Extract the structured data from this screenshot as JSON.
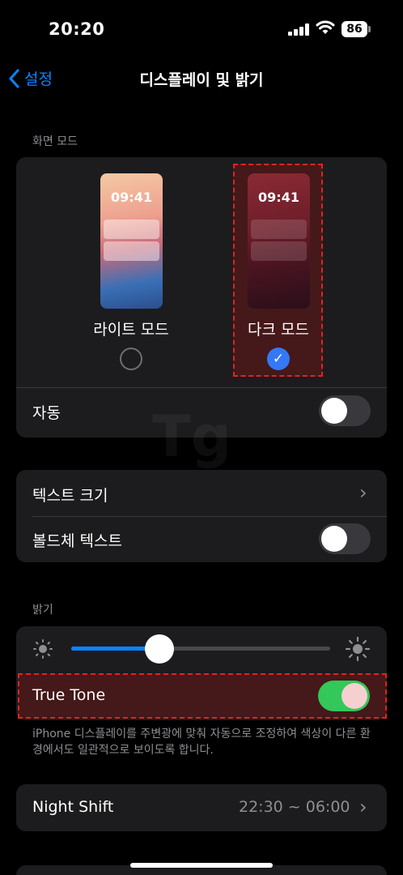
{
  "status_bar": {
    "time": "20:20",
    "battery": "86"
  },
  "nav": {
    "back_label": "설정",
    "title": "디스플레이 및 밝기"
  },
  "appearance": {
    "section_header": "화면 모드",
    "light": {
      "clock": "09:41",
      "label": "라이트 모드",
      "selected": false
    },
    "dark": {
      "clock": "09:41",
      "label": "다크 모드",
      "selected": true
    },
    "automatic_label": "자동",
    "automatic_on": false
  },
  "text": {
    "text_size_label": "텍스트 크기",
    "bold_text_label": "볼드체 텍스트",
    "bold_text_on": false
  },
  "brightness": {
    "section_header": "밝기",
    "level": 0.34,
    "true_tone_label": "True Tone",
    "true_tone_on": true,
    "footer": "iPhone 디스플레이를 주변광에 맞춰 자동으로 조정하여 색상이 다른 환경에서도 일관적으로 보이도록 합니다."
  },
  "night_shift": {
    "label": "Night Shift",
    "value": "22:30 ~ 06:00"
  },
  "watermark": "Tg",
  "colors": {
    "accent": "#0a84ff",
    "toggle_on": "#34c759",
    "highlight": "#e02424"
  }
}
